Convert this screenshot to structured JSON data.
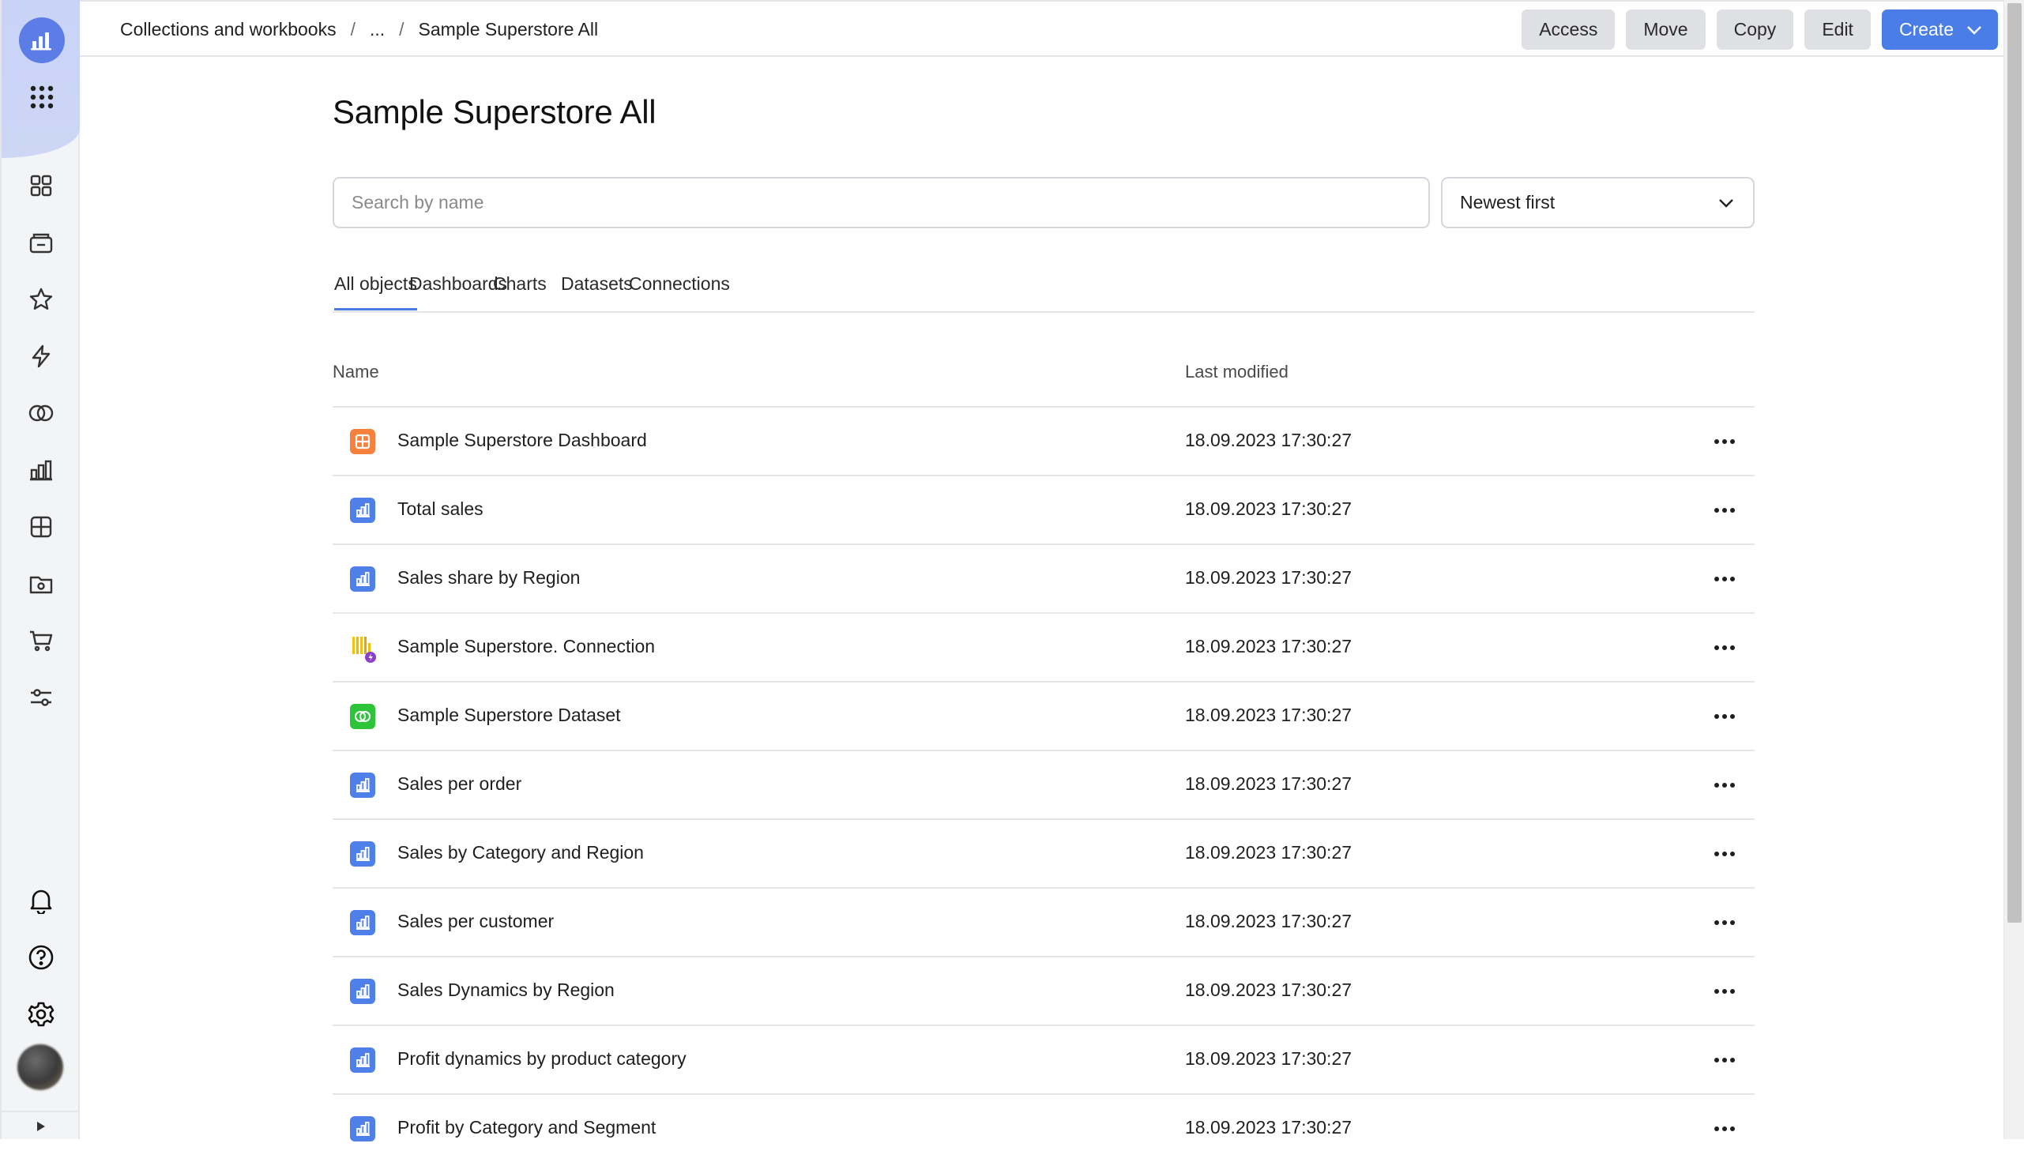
{
  "breadcrumb": {
    "root": "Collections and workbooks",
    "ellipsis": "...",
    "current": "Sample Superstore All"
  },
  "actions": {
    "access": "Access",
    "move": "Move",
    "copy": "Copy",
    "edit": "Edit",
    "create": "Create"
  },
  "page_title": "Sample Superstore All",
  "search": {
    "placeholder": "Search by name",
    "value": ""
  },
  "sort": {
    "selected": "Newest first"
  },
  "tabs": [
    {
      "label": "All objects",
      "active": true
    },
    {
      "label": "Dashboards",
      "active": false
    },
    {
      "label": "Charts",
      "active": false
    },
    {
      "label": "Datasets",
      "active": false
    },
    {
      "label": "Connections",
      "active": false
    }
  ],
  "columns": {
    "name": "Name",
    "modified": "Last modified"
  },
  "rows": [
    {
      "name": "Sample Superstore Dashboard",
      "modified": "18.09.2023 17:30:27",
      "icon": "dashboard-icon"
    },
    {
      "name": "Total sales",
      "modified": "18.09.2023 17:30:27",
      "icon": "chart-icon"
    },
    {
      "name": "Sales share by Region",
      "modified": "18.09.2023 17:30:27",
      "icon": "chart-icon"
    },
    {
      "name": "Sample Superstore. Connection",
      "modified": "18.09.2023 17:30:27",
      "icon": "connection-icon"
    },
    {
      "name": "Sample Superstore Dataset",
      "modified": "18.09.2023 17:30:27",
      "icon": "dataset-icon"
    },
    {
      "name": "Sales per order",
      "modified": "18.09.2023 17:30:27",
      "icon": "chart-icon"
    },
    {
      "name": "Sales by Category and Region",
      "modified": "18.09.2023 17:30:27",
      "icon": "chart-icon"
    },
    {
      "name": "Sales per customer",
      "modified": "18.09.2023 17:30:27",
      "icon": "chart-icon"
    },
    {
      "name": "Sales Dynamics by Region",
      "modified": "18.09.2023 17:30:27",
      "icon": "chart-icon"
    },
    {
      "name": "Profit dynamics by product category",
      "modified": "18.09.2023 17:30:27",
      "icon": "chart-icon"
    },
    {
      "name": "Profit by Category and Segment",
      "modified": "18.09.2023 17:30:27",
      "icon": "chart-icon"
    }
  ],
  "colors": {
    "accent": "#4a7de6",
    "dashboard": "#f5813c",
    "chart": "#4f7fe8",
    "dataset": "#2ec43a",
    "connection": "#f4c20d"
  }
}
